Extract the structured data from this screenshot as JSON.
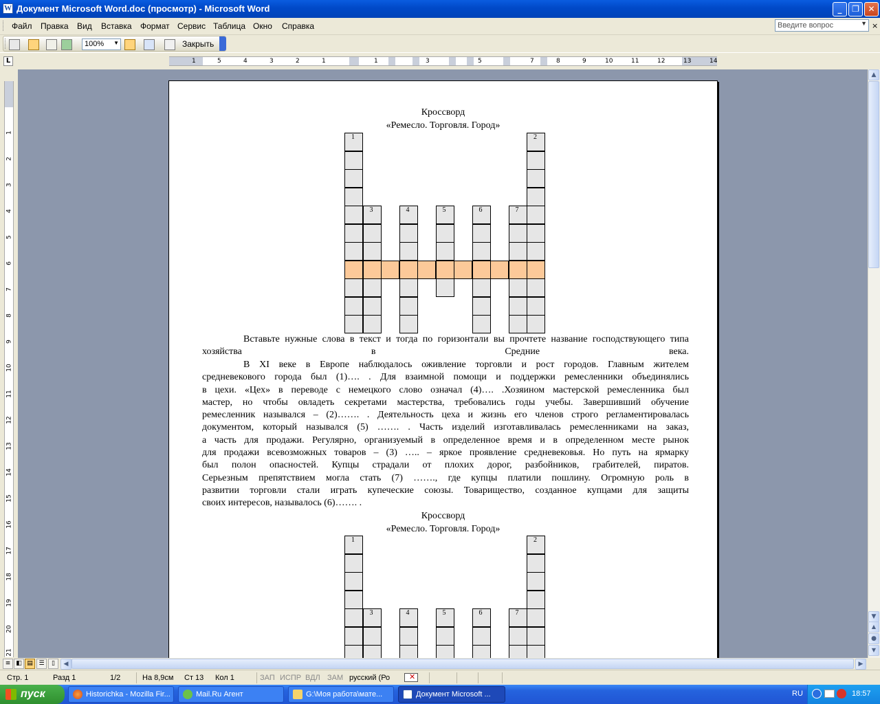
{
  "window": {
    "title": "Документ Microsoft Word.doc (просмотр) - Microsoft Word",
    "app_icon": "word-icon"
  },
  "menu": {
    "items": [
      "Файл",
      "Правка",
      "Вид",
      "Вставка",
      "Формат",
      "Сервис",
      "Таблица",
      "Окно",
      "Справка"
    ],
    "ask_placeholder": "Введите вопрос"
  },
  "toolbar": {
    "zoom": "100%",
    "close_label": "Закрыть"
  },
  "ruler": {
    "numbers": [
      "1",
      "6",
      "5",
      "4",
      "3",
      "2",
      "1",
      "1",
      "3",
      "5",
      "7",
      "8",
      "9",
      "10",
      "11",
      "12",
      "13",
      "14"
    ]
  },
  "vruler": {
    "numbers": [
      "1",
      "2",
      "3",
      "4",
      "5",
      "6",
      "7",
      "8",
      "9",
      "10",
      "11",
      "12",
      "13",
      "14",
      "15",
      "16",
      "17",
      "18",
      "19",
      "20",
      "21"
    ]
  },
  "document": {
    "heading_title": "Кроссворд",
    "heading_subtitle": "«Ремесло. Торговля. Город»",
    "crossword_numbers": [
      "1",
      "2",
      "3",
      "4",
      "5",
      "6",
      "7"
    ],
    "instructions": "Вставьте нужные слова в текст и тогда по горизонтали вы прочтете название господствующего типа хозяйства в Средние века.",
    "body_lines": [
      "В XI веке в Европе наблюдалось оживление торговли и рост городов. Главным жителем",
      "средневекового города был   (1)…. . Для взаимной  помощи и поддержки ремесленники объединялись",
      "в цехи. «Цех»  в переводе с немецкого слово означал (4)…. .Хозяином мастерской  ремесленника был",
      "мастер, но чтобы овладеть секретами мастерства, требовались годы учебы. Завершивший обучение",
      "ремесленник назывался – (2)……. . Деятельность цеха  и жизнь его членов строго регламентировалась",
      "документом, который назывался (5) ……. . Часть изделий изготавливалась  ремесленниками на заказ,",
      "а часть для продажи. Регулярно, организуемый в определенное время и в определенном месте рынок",
      "для продажи всевозможных товаров – (3) ….. – яркое проявление  средневековья. Но путь на ярмарку",
      "был полон опасностей. Купцы страдали от плохих дорог, разбойников, грабителей, пиратов.",
      "Серьезным препятствием могла стать (7) ……., где купцы платили пошлину. Огромную роль в",
      "развитии торговли стали играть купеческие союзы. Товарищество, созданное купцами для защиты",
      "своих интересов, называлось (6)……. ."
    ]
  },
  "status": {
    "page": "Стр. 1",
    "section": "Разд 1",
    "pages": "1/2",
    "at": "На 8,9см",
    "line": "Ст 13",
    "col": "Кол 1",
    "rec": "ЗАП",
    "trk": "ИСПР",
    "ext": "ВДЛ",
    "ovr": "ЗАМ",
    "lang": "русский (Ро"
  },
  "taskbar": {
    "start": "пуск",
    "tasks": [
      {
        "label": "Historichka - Mozilla Fir...",
        "icon": "firefox-icon"
      },
      {
        "label": "Mail.Ru Агент",
        "icon": "mailru-agent-icon"
      },
      {
        "label": "G:\\Моя работа\\мате...",
        "icon": "folder-icon"
      },
      {
        "label": "Документ Microsoft ...",
        "icon": "word-icon"
      }
    ],
    "lang": "RU",
    "time": "18:57"
  }
}
